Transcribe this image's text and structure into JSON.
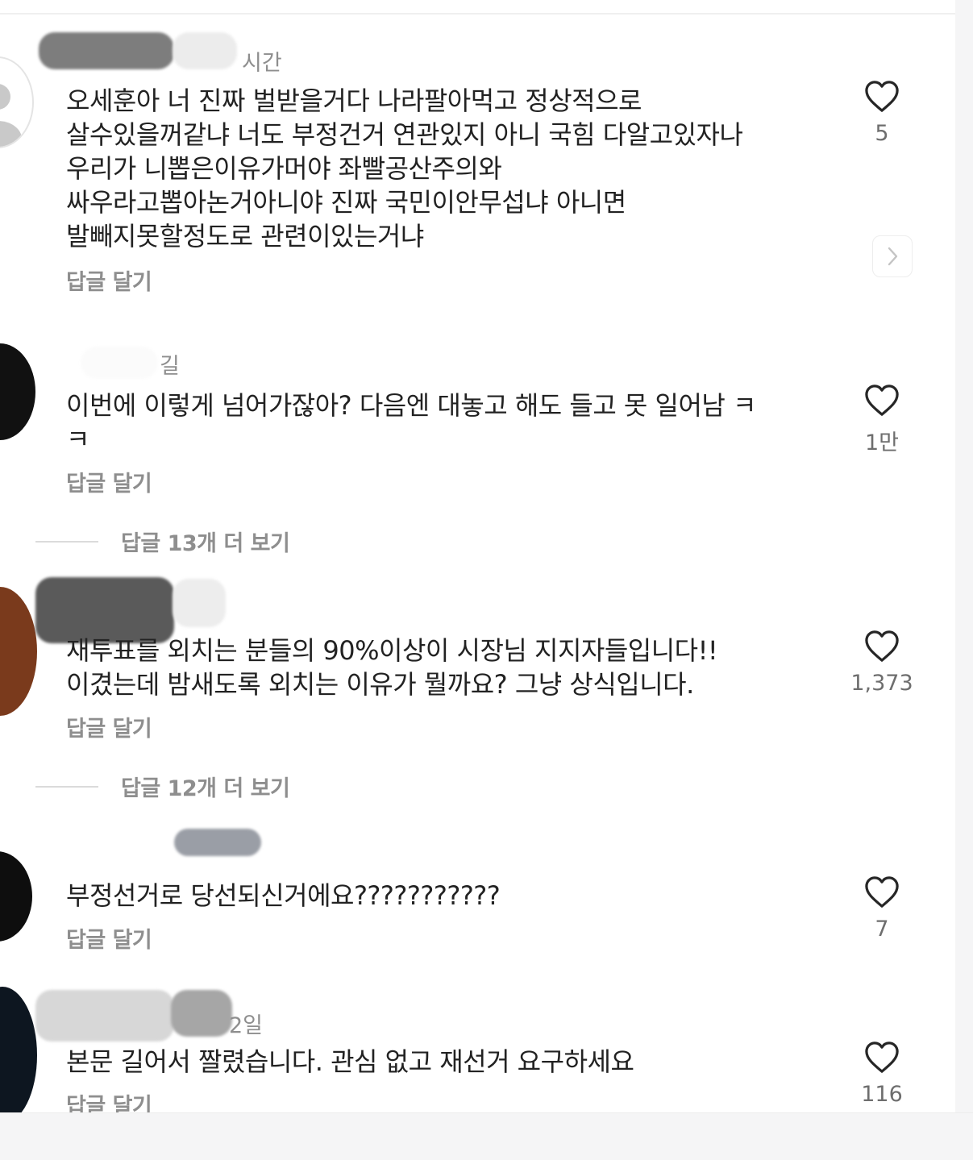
{
  "comments": [
    {
      "time": "시간",
      "text": "오세훈아 너 진짜 벌받을거다 나라팔아먹고 정상적으로\n살수있을꺼같냐 너도 부정건거 연관있지 아니 국힘 다알고있자나\n우리가 니뽑은이유가머야  좌빨공산주의와\n싸우라고뽑아논거아니야 진짜 국민이안무섭냐 아니면\n발빼지못할정도로 관련이있는거냐",
      "reply_label": "답글 달기",
      "likes": "5"
    },
    {
      "time": "길",
      "text": "이번에 이렇게 넘어가잖아? 다음엔 대놓고 해도 들고 못 일어남 ㅋ\nㅋ",
      "reply_label": "답글 달기",
      "likes": "1만",
      "more_replies": "답글 13개 더 보기"
    },
    {
      "time": "",
      "text": "재투표를 외치는 분들의 90%이상이 시장님 지지자들입니다!!\n이겼는데 밤새도록 외치는 이유가 뭘까요? 그냥 상식입니다.",
      "reply_label": "답글 달기",
      "likes": "1,373",
      "more_replies": "답글 12개 더 보기"
    },
    {
      "time": "",
      "text": "부정선거로 당선되신거에요???????????",
      "reply_label": "답글 달기",
      "likes": "7"
    },
    {
      "time": "2일",
      "text": "본문 길어서 짤렸습니다. 관심 없고 재선거 요구하세요",
      "reply_label": "답글 달기",
      "likes": "116"
    }
  ],
  "icons": {
    "like": "heart-outline-icon",
    "next": "chevron-right-icon",
    "avatar": "default-avatar-icon"
  },
  "colors": {
    "muted_text": "#8e8e8e",
    "body_text": "#222222",
    "icon": "#262626"
  }
}
